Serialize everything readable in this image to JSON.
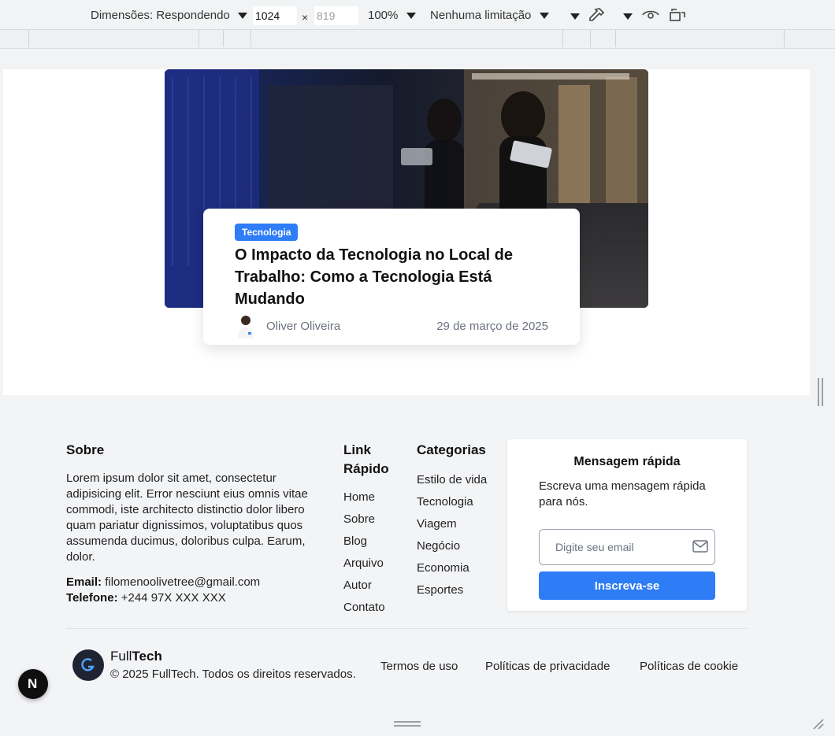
{
  "devtools": {
    "dimensions_label": "Dimensões: Respondendo",
    "width": "1024",
    "height": "819",
    "zoom": "100%",
    "throttling": "Nenhuma limitação"
  },
  "post": {
    "category": "Tecnologia",
    "title": "O Impacto da Tecnologia no Local de Trabalho: Como a Tecnologia Está Mudando",
    "author": "Oliver Oliveira",
    "date": "29 de março de 2025"
  },
  "footer": {
    "about": {
      "title": "Sobre",
      "text": "Lorem ipsum dolor sit amet, consectetur adipisicing elit. Error nesciunt eius omnis vitae commodi, iste architecto distinctio dolor libero quam pariatur dignissimos, voluptatibus quos assumenda ducimus, doloribus culpa. Earum, dolor.",
      "email_label": "Email:",
      "email": "filomenoolivetree@gmail.com",
      "phone_label": "Telefone:",
      "phone": "+244 97X XXX XXX"
    },
    "quick_links": {
      "title": "Link Rápido",
      "items": [
        "Home",
        "Sobre",
        "Blog",
        "Arquivo",
        "Autor",
        "Contato"
      ]
    },
    "categories": {
      "title": "Categorias",
      "items": [
        "Estilo de vida",
        "Tecnologia",
        "Viagem",
        "Negócio",
        "Economia",
        "Esportes"
      ]
    },
    "newsletter": {
      "title": "Mensagem rápida",
      "text": "Escreva uma mensagem rápida para nós.",
      "placeholder": "Digite seu email",
      "button": "Inscreva-se"
    },
    "brand_light": "Full",
    "brand_bold": "Tech",
    "copyright": "© 2025 FullTech. Todos os direitos reservados.",
    "legal": [
      "Termos de uso",
      "Políticas de privacidade",
      "Políticas de cookie"
    ]
  },
  "next_badge": "N"
}
